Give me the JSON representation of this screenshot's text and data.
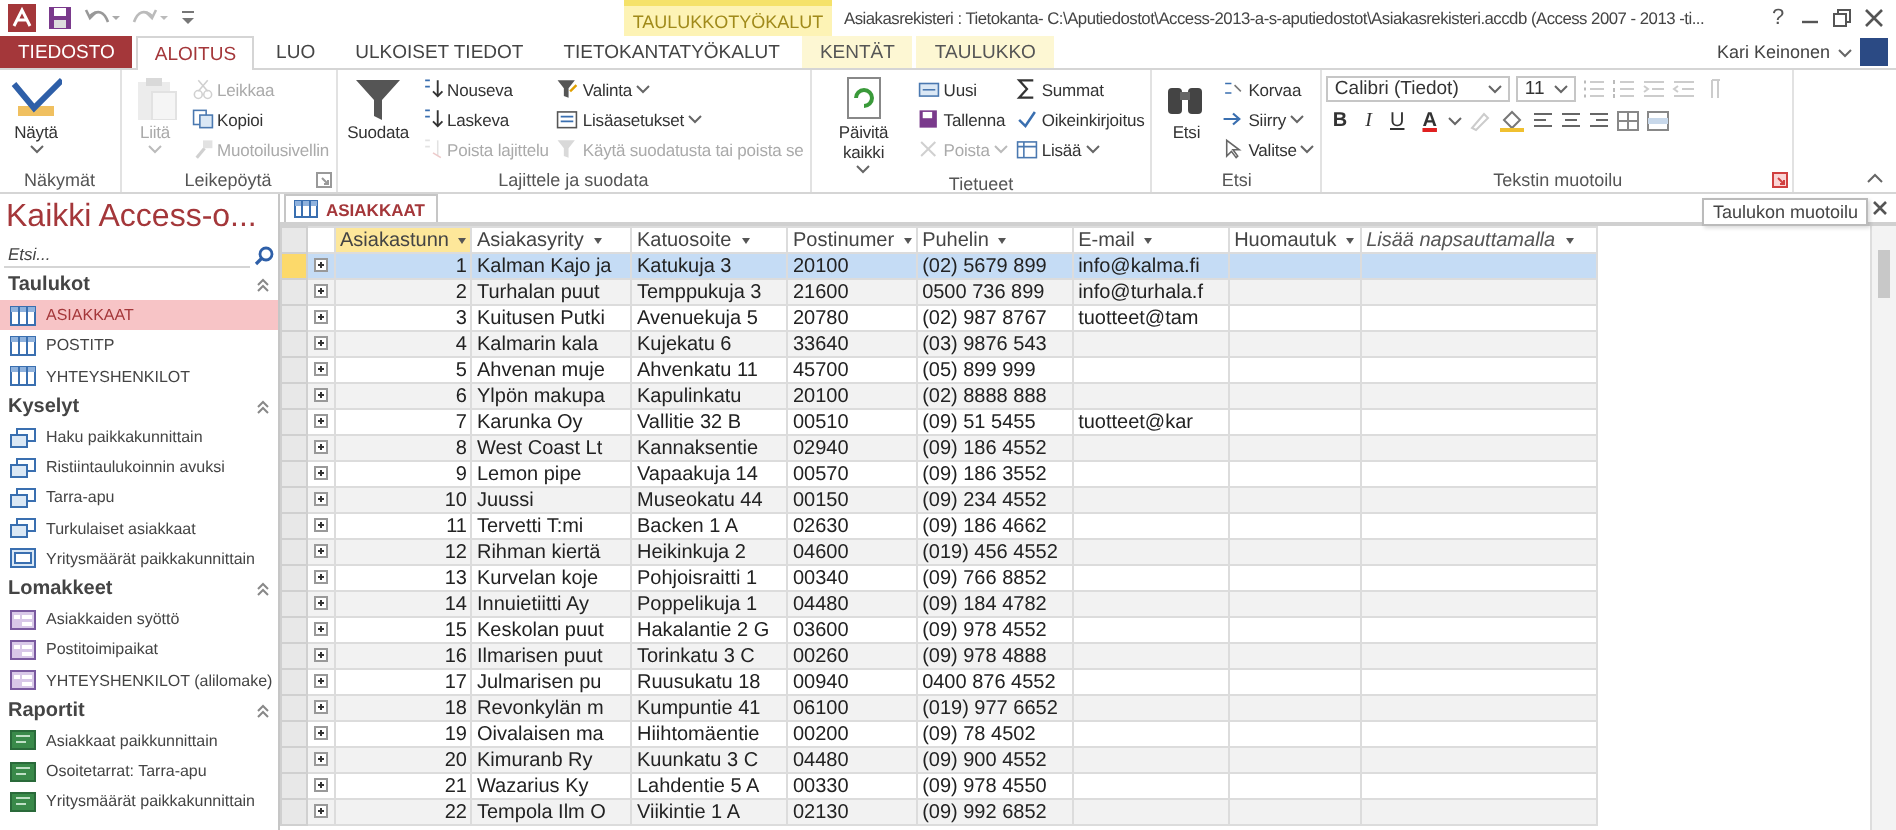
{
  "titlebar": {
    "context_header": "TAULUKKOTYÖKALUT",
    "title": "Asiakasrekisteri : Tietokanta- C:\\Aputiedostot\\Access-2013-a-s-aputiedostot\\Asiakasrekisteri.accdb (Access 2007 - 2013 -ti...",
    "help": "?"
  },
  "tabs": [
    {
      "label": "TIEDOSTO",
      "kind": "file",
      "selected": false
    },
    {
      "label": "ALOITUS",
      "kind": "normal",
      "selected": true
    },
    {
      "label": "LUO",
      "kind": "normal",
      "selected": false
    },
    {
      "label": "ULKOISET TIEDOT",
      "kind": "normal",
      "selected": false
    },
    {
      "label": "TIETOKANTATYÖKALUT",
      "kind": "normal",
      "selected": false
    },
    {
      "label": "KENTÄT",
      "kind": "context",
      "selected": false
    },
    {
      "label": "TAULUKKO",
      "kind": "context",
      "selected": false
    }
  ],
  "user": {
    "name": "Kari Keinonen"
  },
  "ribbon_groups": [
    {
      "label": "Näkymät",
      "columns": [
        [
          {
            "label": "Näytä",
            "kind": "large",
            "disabled": false,
            "dropdown": true
          }
        ]
      ]
    },
    {
      "label": "Leikepöytä",
      "launcher": true,
      "columns": [
        [
          {
            "label": "Liitä",
            "kind": "large",
            "disabled": true,
            "dropdown": true
          }
        ],
        [
          {
            "label": "Leikkaa",
            "kind": "small",
            "disabled": true,
            "dropdown": false
          },
          {
            "label": "Kopioi",
            "kind": "small",
            "disabled": false,
            "dropdown": false
          },
          {
            "label": "Muotoilusivellin",
            "kind": "small",
            "disabled": true,
            "dropdown": false
          }
        ]
      ]
    },
    {
      "label": "Lajittele ja suodata",
      "columns": [
        [
          {
            "label": "Suodata",
            "kind": "large",
            "disabled": false,
            "dropdown": false
          }
        ],
        [
          {
            "label": "Nouseva",
            "kind": "small",
            "disabled": false,
            "dropdown": false
          },
          {
            "label": "Laskeva",
            "kind": "small",
            "disabled": false,
            "dropdown": false
          },
          {
            "label": "Poista lajittelu",
            "kind": "small",
            "disabled": true,
            "dropdown": false
          }
        ],
        [
          {
            "label": "Valinta",
            "kind": "small",
            "disabled": false,
            "dropdown": true
          },
          {
            "label": "Lisäasetukset",
            "kind": "small",
            "disabled": false,
            "dropdown": true
          },
          {
            "label": "Käytä suodatusta tai poista se",
            "kind": "small",
            "disabled": true,
            "dropdown": false
          }
        ]
      ]
    },
    {
      "label": "Tietueet",
      "columns": [
        [
          {
            "label": "Päivitä kaikki",
            "kind": "large",
            "disabled": false,
            "dropdown": true
          }
        ],
        [
          {
            "label": "Uusi",
            "kind": "small",
            "disabled": false,
            "dropdown": false
          },
          {
            "label": "Tallenna",
            "kind": "small",
            "disabled": false,
            "dropdown": false
          },
          {
            "label": "Poista",
            "kind": "small",
            "disabled": true,
            "dropdown": true
          }
        ],
        [
          {
            "label": "Summat",
            "kind": "small",
            "disabled": false,
            "dropdown": false
          },
          {
            "label": "Oikeinkirjoitus",
            "kind": "small",
            "disabled": false,
            "dropdown": false
          },
          {
            "label": "Lisää",
            "kind": "small",
            "disabled": false,
            "dropdown": true
          }
        ]
      ]
    },
    {
      "label": "Etsi",
      "columns": [
        [
          {
            "label": "Etsi",
            "kind": "large",
            "disabled": false,
            "dropdown": false
          }
        ],
        [
          {
            "label": "Korvaa",
            "kind": "small",
            "disabled": false,
            "dropdown": false
          },
          {
            "label": "Siirry",
            "kind": "small",
            "disabled": false,
            "dropdown": true
          },
          {
            "label": "Valitse",
            "kind": "small",
            "disabled": false,
            "dropdown": true
          }
        ]
      ]
    }
  ],
  "text_format": {
    "label": "Tekstin muotoilu",
    "launcher": true,
    "launcher_highlighted": true,
    "font_name": "Calibri (Tiedot)",
    "font_size": "11",
    "buttons": [
      {
        "label": "B",
        "kind": "bold"
      },
      {
        "label": "I",
        "kind": "italic"
      },
      {
        "label": "U",
        "kind": "underline"
      },
      {
        "label": "A",
        "kind": "font-color"
      }
    ]
  },
  "tooltip": "Taulukon muotoilu",
  "nav": {
    "title": "Kaikki Access-o...",
    "search_placeholder": "Etsi...",
    "groups": [
      {
        "label": "Taulukot",
        "items": [
          {
            "label": "ASIAKKAAT",
            "kind": "table",
            "selected": true
          },
          {
            "label": "POSTITP",
            "kind": "table",
            "selected": false
          },
          {
            "label": "YHTEYSHENKILOT",
            "kind": "table",
            "selected": false
          }
        ]
      },
      {
        "label": "Kyselyt",
        "items": [
          {
            "label": "Haku paikkakunnittain",
            "kind": "query",
            "selected": false
          },
          {
            "label": "Ristiintaulukoinnin avuksi",
            "kind": "query",
            "selected": false
          },
          {
            "label": "Tarra-apu",
            "kind": "query",
            "selected": false
          },
          {
            "label": "Turkulaiset asiakkaat",
            "kind": "query",
            "selected": false
          },
          {
            "label": "Yritysmäärät paikkakunnittain",
            "kind": "crosstab",
            "selected": false
          }
        ]
      },
      {
        "label": "Lomakkeet",
        "items": [
          {
            "label": "Asiakkaiden syöttö",
            "kind": "form",
            "selected": false
          },
          {
            "label": "Postitoimipaikat",
            "kind": "form",
            "selected": false
          },
          {
            "label": "YHTEYSHENKILOT (alilomake)",
            "kind": "form",
            "selected": false
          }
        ]
      },
      {
        "label": "Raportit",
        "items": [
          {
            "label": "Asiakkaat paikkunnittain",
            "kind": "report",
            "selected": false
          },
          {
            "label": "Osoitetarrat: Tarra-apu",
            "kind": "report",
            "selected": false
          },
          {
            "label": "Yritysmäärät paikkakunnittain",
            "kind": "report",
            "selected": false
          }
        ]
      }
    ]
  },
  "document_tab": {
    "label": "ASIAKKAAT"
  },
  "table": {
    "columns": [
      {
        "label": "Asiakastunn",
        "kind": "active"
      },
      {
        "label": "Asiakasyrity",
        "kind": "field"
      },
      {
        "label": "Katuosoite",
        "kind": "field"
      },
      {
        "label": "Postinumer",
        "kind": "field"
      },
      {
        "label": "Puhelin",
        "kind": "field"
      },
      {
        "label": "E-mail",
        "kind": "field"
      },
      {
        "label": "Huomautuk",
        "kind": "field"
      },
      {
        "label": "Lisää napsauttamalla",
        "kind": "add"
      }
    ],
    "rows": [
      {
        "selected": true,
        "cells": [
          "1",
          "Kalman Kajo ja",
          "Katukuja 3",
          "20100",
          "(02) 5679 899",
          "info@kalma.fi"
        ]
      },
      {
        "selected": false,
        "cells": [
          "2",
          "Turhalan puut",
          "Temppukuja 3",
          "21600",
          "0500 736 899",
          "info@turhala.f"
        ]
      },
      {
        "selected": false,
        "cells": [
          "3",
          "Kuitusen Putki",
          "Avenuekuja 5",
          "20780",
          "(02) 987 8767",
          "tuotteet@tam"
        ]
      },
      {
        "selected": false,
        "cells": [
          "4",
          "Kalmarin kala",
          "Kujekatu 6",
          "33640",
          "(03) 9876 543"
        ]
      },
      {
        "selected": false,
        "cells": [
          "5",
          "Ahvenan muje",
          "Ahvenkatu 11",
          "45700",
          "(05) 899 999"
        ]
      },
      {
        "selected": false,
        "cells": [
          "6",
          "Ylpön makupa",
          "Kapulinkatu",
          "20100",
          "(02) 8888 888"
        ]
      },
      {
        "selected": false,
        "cells": [
          "7",
          "Karunka Oy",
          "Vallitie 32 B",
          "00510",
          "(09) 51 5455",
          "tuotteet@kar"
        ]
      },
      {
        "selected": false,
        "cells": [
          "8",
          "West Coast Lt",
          "Kannaksentie",
          "02940",
          "(09) 186 4552"
        ]
      },
      {
        "selected": false,
        "cells": [
          "9",
          "Lemon pipe",
          "Vapaakuja 14",
          "00570",
          "(09) 186 3552"
        ]
      },
      {
        "selected": false,
        "cells": [
          "10",
          "Juussi",
          "Museokatu 44",
          "00150",
          "(09) 234 4552"
        ]
      },
      {
        "selected": false,
        "cells": [
          "11",
          "Tervetti T:mi",
          "Backen 1 A",
          "02630",
          "(09) 186 4662"
        ]
      },
      {
        "selected": false,
        "cells": [
          "12",
          "Rihman kiertä",
          "Heikinkuja 2",
          "04600",
          "(019) 456 4552"
        ]
      },
      {
        "selected": false,
        "cells": [
          "13",
          "Kurvelan koje",
          "Pohjoisraitti 1",
          "00340",
          "(09) 766 8852"
        ]
      },
      {
        "selected": false,
        "cells": [
          "14",
          "Innuietiitti Ay",
          "Poppelikuja 1",
          "04480",
          "(09) 184 4782"
        ]
      },
      {
        "selected": false,
        "cells": [
          "15",
          "Keskolan puut",
          "Hakalantie 2 G",
          "03600",
          "(09) 978 4552"
        ]
      },
      {
        "selected": false,
        "cells": [
          "16",
          "Ilmarisen puut",
          "Torinkatu 3 C",
          "00260",
          "(09) 978 4888"
        ]
      },
      {
        "selected": false,
        "cells": [
          "17",
          "Julmarisen pu",
          "Ruusukatu 18",
          "00940",
          "0400 876 4552"
        ]
      },
      {
        "selected": false,
        "cells": [
          "18",
          "Revonkylän m",
          "Kumpuntie 41",
          "06100",
          "(019) 977 6652"
        ]
      },
      {
        "selected": false,
        "cells": [
          "19",
          "Oivalaisen ma",
          "Hiihtomäentie",
          "00200",
          "(09) 78 4502"
        ]
      },
      {
        "selected": false,
        "cells": [
          "20",
          "Kimuranb Ry",
          "Kuunkatu 3 C",
          "04480",
          "(09) 900 4552"
        ]
      },
      {
        "selected": false,
        "cells": [
          "21",
          "Wazarius Ky",
          "Lahdentie 5 A",
          "00330",
          "(09) 978 4550"
        ]
      },
      {
        "selected": false,
        "cells": [
          "22",
          "Tempola Ilm O",
          "Viikintie 1 A",
          "02130",
          "(09) 992 6852"
        ]
      }
    ]
  }
}
